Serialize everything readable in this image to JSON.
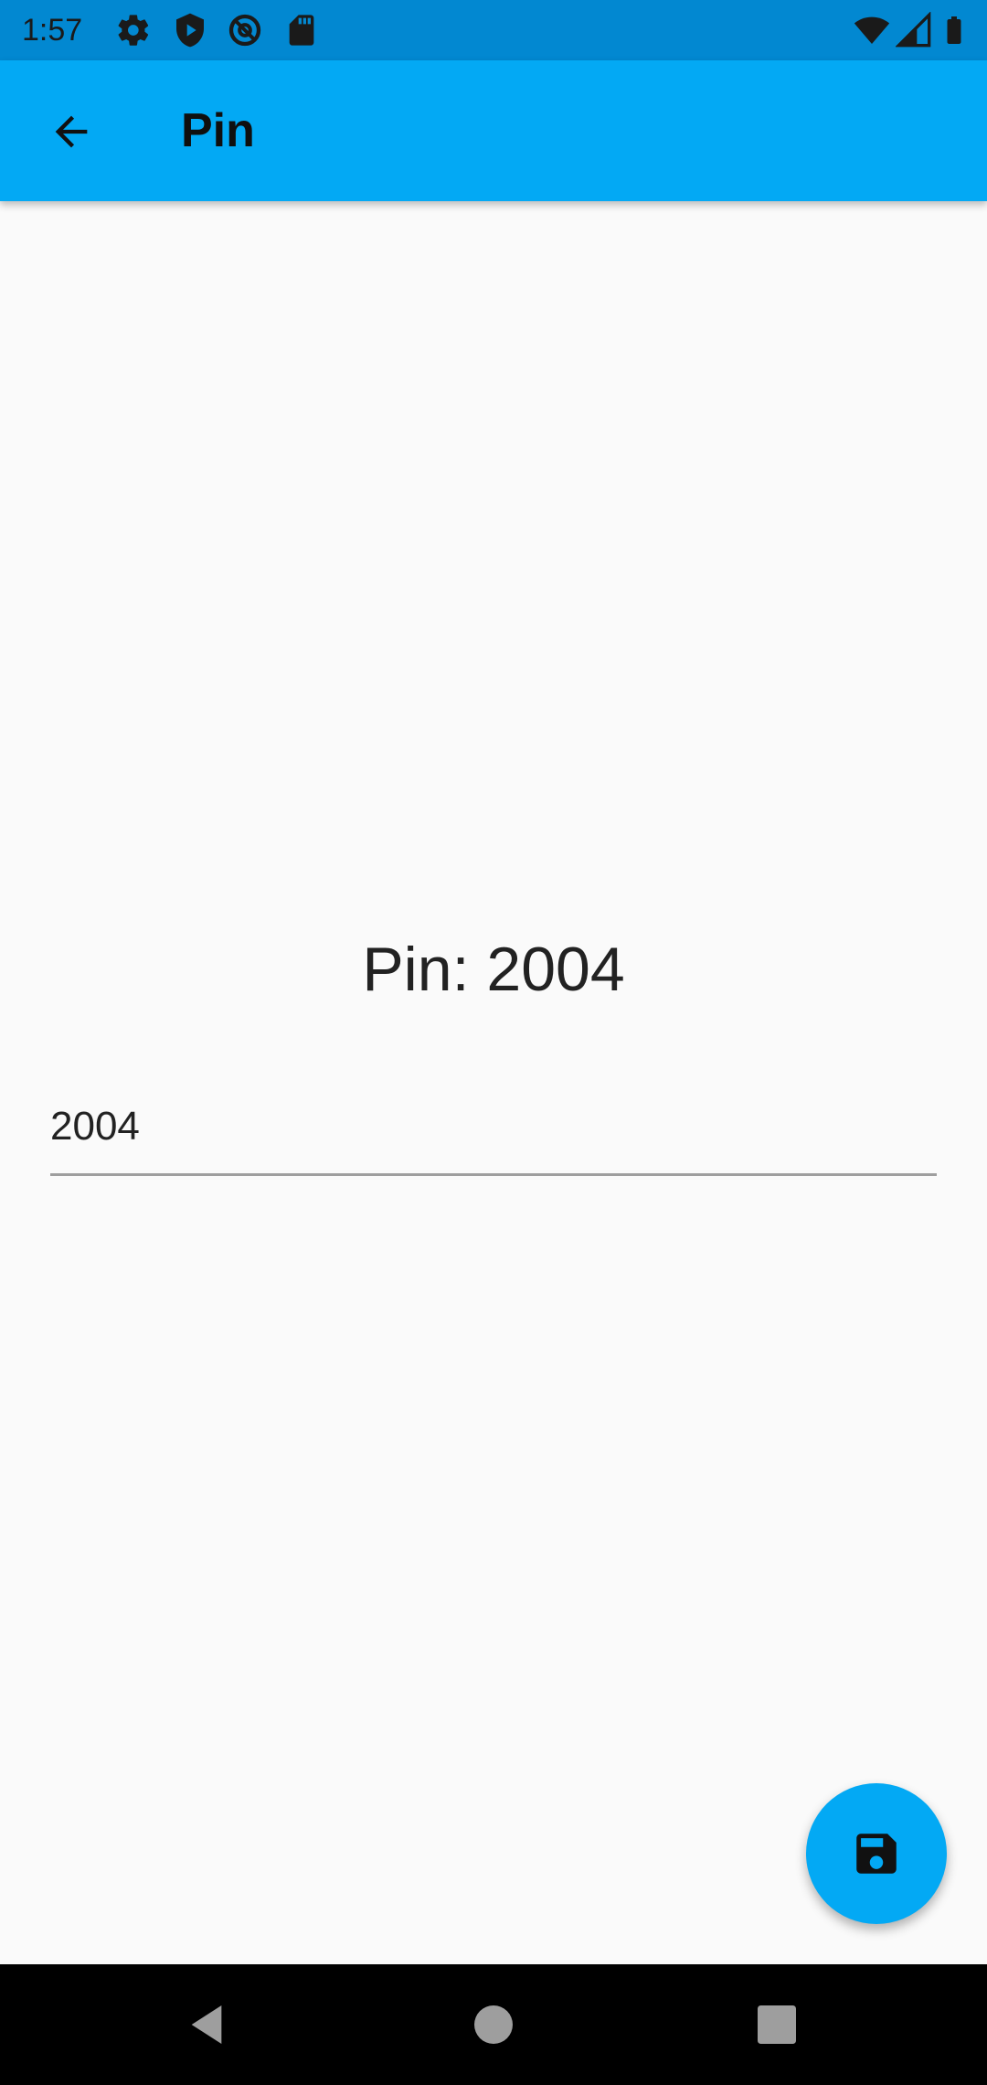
{
  "status_bar": {
    "time": "1:57",
    "icons_left": [
      "settings-icon",
      "shield-play-icon",
      "at-sign-icon",
      "sd-card-icon"
    ],
    "icons_right": [
      "wifi-icon",
      "cell-signal-icon",
      "battery-icon"
    ]
  },
  "app_bar": {
    "title": "Pin",
    "back_icon": "arrow-back-icon"
  },
  "main": {
    "pin_display": "Pin: 2004",
    "pin_input_value": "2004"
  },
  "fab": {
    "icon": "save-icon"
  },
  "nav_bar": {
    "buttons": [
      "back-triangle-icon",
      "home-circle-icon",
      "recents-square-icon"
    ]
  },
  "colors": {
    "status_bar": "#0288d1",
    "app_bar": "#03a9f4",
    "fab": "#03a9f4",
    "background": "#fafafa",
    "nav_bar": "#000000"
  }
}
